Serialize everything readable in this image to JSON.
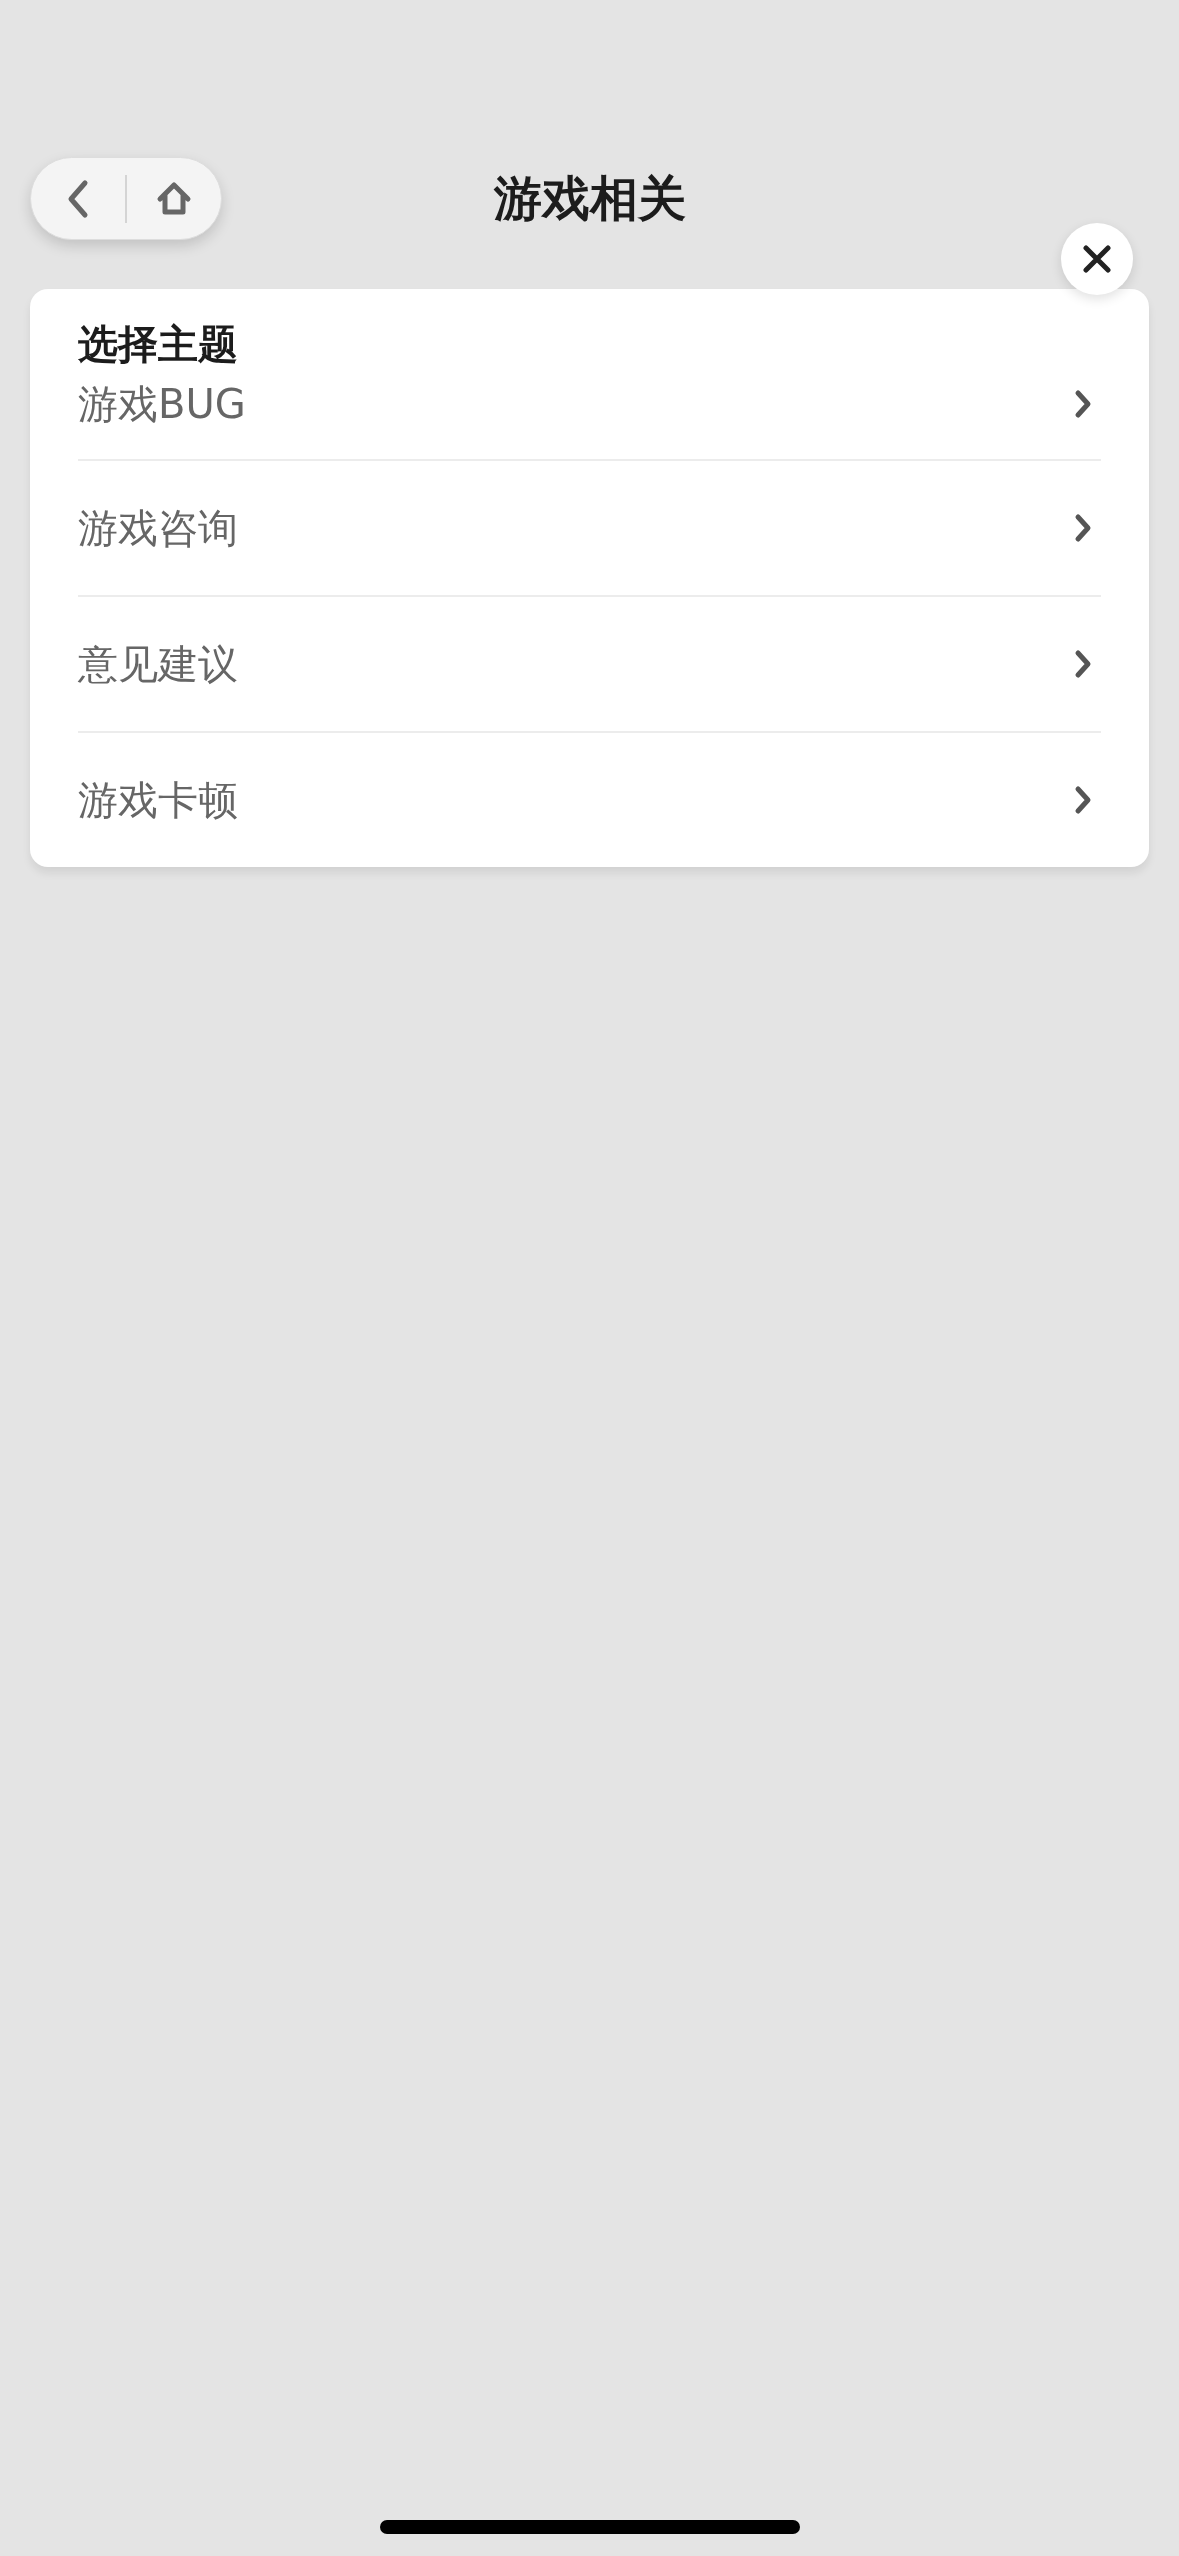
{
  "nav": {
    "title": "游戏相关"
  },
  "panel": {
    "heading": "选择主题",
    "items": [
      {
        "label": "游戏BUG"
      },
      {
        "label": "游戏咨询"
      },
      {
        "label": "意见建议"
      },
      {
        "label": "游戏卡顿"
      }
    ]
  }
}
